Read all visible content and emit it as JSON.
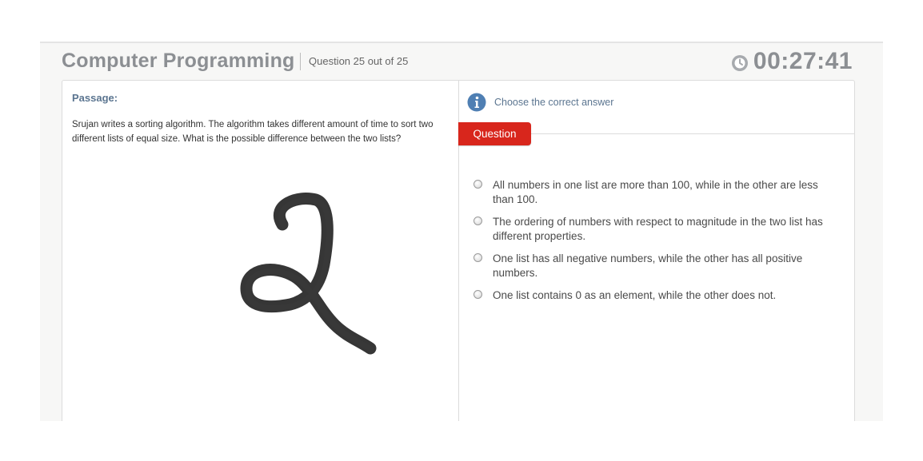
{
  "header": {
    "title": "Computer Programming",
    "question_counter": "Question 25 out of 25",
    "timer": "00:27:41",
    "timer_icon": "clock-icon"
  },
  "passage": {
    "label": "Passage:",
    "text": "Srujan writes a sorting algorithm. The algorithm takes different amount of time to sort two different lists of equal size. What is the possible difference between the two lists?"
  },
  "question_panel": {
    "info_icon": "info-icon",
    "instruction": "Choose the correct answer",
    "tab_label": "Question",
    "options": [
      {
        "text": "All numbers in one list are more than 100, while in the other are less than 100.",
        "selected": false
      },
      {
        "text": "The ordering of numbers with respect to magnitude in the two list has different properties.",
        "selected": false
      },
      {
        "text": "One list has all negative numbers, while the other has all positive numbers.",
        "selected": false
      },
      {
        "text": "One list contains 0 as an element, while the other does not.",
        "selected": false
      }
    ]
  },
  "colors": {
    "accent_red": "#d8261c",
    "header_gray": "#8c8f93",
    "label_blue": "#5b7590",
    "info_blue": "#4f7fb3"
  }
}
